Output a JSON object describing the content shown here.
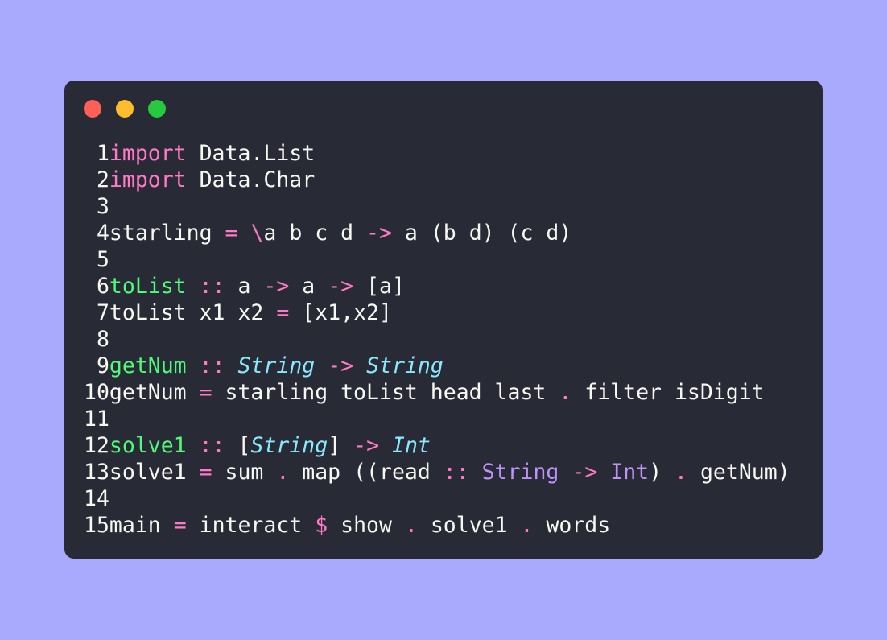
{
  "window": {
    "controls": [
      {
        "name": "close",
        "color": "#ff5f56"
      },
      {
        "name": "minimize",
        "color": "#ffbd2e"
      },
      {
        "name": "maximize",
        "color": "#27c93f"
      }
    ]
  },
  "code": {
    "language": "haskell",
    "lines": [
      {
        "n": "1",
        "tokens": [
          [
            "import",
            "k"
          ],
          [
            " Data.List",
            "p"
          ]
        ]
      },
      {
        "n": "2",
        "tokens": [
          [
            "import",
            "k"
          ],
          [
            " Data.Char",
            "p"
          ]
        ]
      },
      {
        "n": "3",
        "tokens": []
      },
      {
        "n": "4",
        "tokens": [
          [
            "starling ",
            "p"
          ],
          [
            "=",
            "o"
          ],
          [
            " ",
            "p"
          ],
          [
            "\\",
            "o"
          ],
          [
            "a b c d ",
            "p"
          ],
          [
            "->",
            "o"
          ],
          [
            " a (b d) (c d)",
            "p"
          ]
        ]
      },
      {
        "n": "5",
        "tokens": []
      },
      {
        "n": "6",
        "tokens": [
          [
            "toList",
            "f"
          ],
          [
            " ",
            "p"
          ],
          [
            "::",
            "o"
          ],
          [
            " a ",
            "p"
          ],
          [
            "->",
            "o"
          ],
          [
            " a ",
            "p"
          ],
          [
            "->",
            "o"
          ],
          [
            " [a]",
            "p"
          ]
        ]
      },
      {
        "n": "7",
        "tokens": [
          [
            "toList x1 x2 ",
            "p"
          ],
          [
            "=",
            "o"
          ],
          [
            " [x1,x2]",
            "p"
          ]
        ]
      },
      {
        "n": "8",
        "tokens": []
      },
      {
        "n": "9",
        "tokens": [
          [
            "getNum",
            "f"
          ],
          [
            " ",
            "p"
          ],
          [
            "::",
            "o"
          ],
          [
            " ",
            "p"
          ],
          [
            "String",
            "ti"
          ],
          [
            " ",
            "p"
          ],
          [
            "->",
            "o"
          ],
          [
            " ",
            "p"
          ],
          [
            "String",
            "ti"
          ]
        ]
      },
      {
        "n": "10",
        "tokens": [
          [
            "getNum ",
            "p"
          ],
          [
            "=",
            "o"
          ],
          [
            " starling toList head last ",
            "p"
          ],
          [
            ".",
            "o"
          ],
          [
            " filter isDigit",
            "p"
          ]
        ]
      },
      {
        "n": "11",
        "tokens": []
      },
      {
        "n": "12",
        "tokens": [
          [
            "solve1",
            "f"
          ],
          [
            " ",
            "p"
          ],
          [
            "::",
            "o"
          ],
          [
            " [",
            "p"
          ],
          [
            "String",
            "ti"
          ],
          [
            "] ",
            "p"
          ],
          [
            "->",
            "o"
          ],
          [
            " ",
            "p"
          ],
          [
            "Int",
            "ti"
          ]
        ]
      },
      {
        "n": "13",
        "tokens": [
          [
            "solve1 ",
            "p"
          ],
          [
            "=",
            "o"
          ],
          [
            " sum ",
            "p"
          ],
          [
            ".",
            "o"
          ],
          [
            " map ((read ",
            "p"
          ],
          [
            "::",
            "o"
          ],
          [
            " ",
            "p"
          ],
          [
            "String",
            "tp"
          ],
          [
            " ",
            "p"
          ],
          [
            "->",
            "o"
          ],
          [
            " ",
            "p"
          ],
          [
            "Int",
            "tp"
          ],
          [
            ") ",
            "p"
          ],
          [
            ".",
            "o"
          ],
          [
            " getNum)",
            "p"
          ]
        ]
      },
      {
        "n": "14",
        "tokens": []
      },
      {
        "n": "15",
        "tokens": [
          [
            "main ",
            "p"
          ],
          [
            "=",
            "o"
          ],
          [
            " interact ",
            "p"
          ],
          [
            "$",
            "o"
          ],
          [
            " show ",
            "p"
          ],
          [
            ".",
            "o"
          ],
          [
            " solve1 ",
            "p"
          ],
          [
            ".",
            "o"
          ],
          [
            " words",
            "p"
          ]
        ]
      }
    ]
  }
}
